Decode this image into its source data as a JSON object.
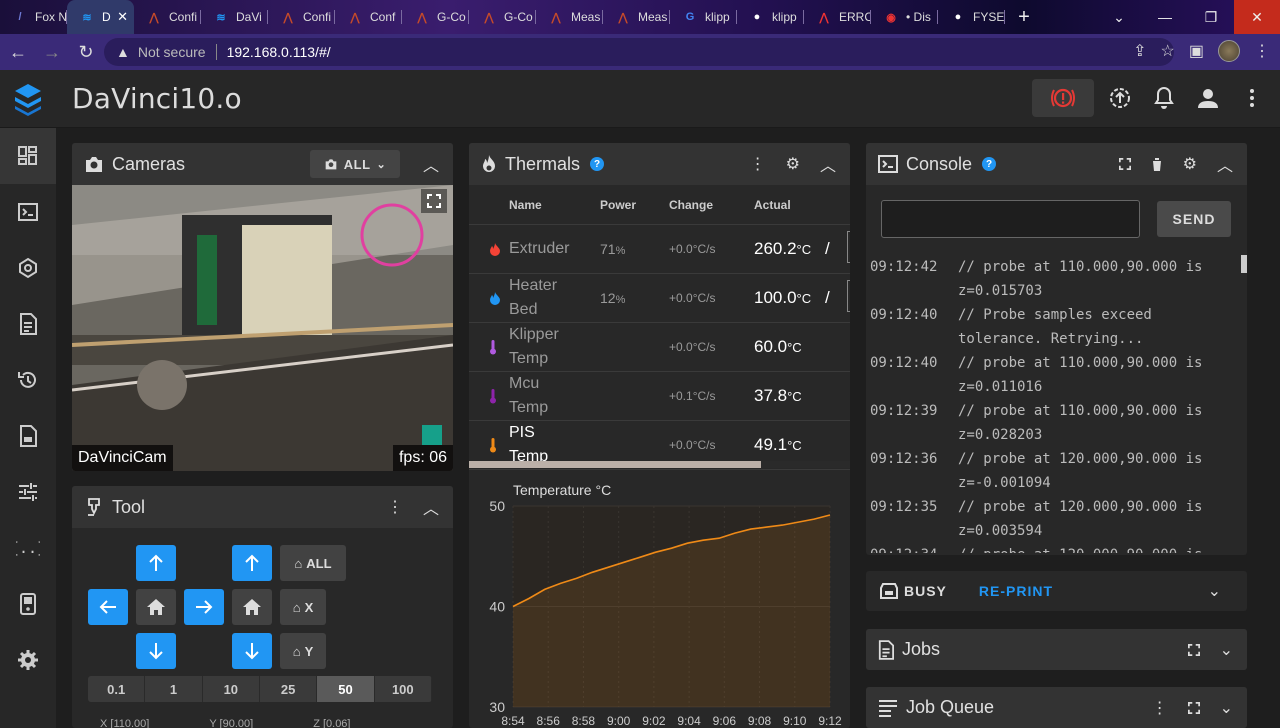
{
  "browser": {
    "tabs": [
      {
        "label": "Fox N",
        "favicon": "fox-icon",
        "color": "#6f7bd6"
      },
      {
        "label": "D",
        "favicon": "mainsail-icon",
        "color": "#2196f3",
        "active": true
      },
      {
        "label": "Confi",
        "favicon": "klipper-icon",
        "color": "#c44a2a"
      },
      {
        "label": "DaVi",
        "favicon": "mainsail-icon",
        "color": "#2196f3"
      },
      {
        "label": "Confi",
        "favicon": "klipper-icon",
        "color": "#c44a2a"
      },
      {
        "label": "Conf",
        "favicon": "klipper-icon",
        "color": "#c44a2a"
      },
      {
        "label": "G-Co",
        "favicon": "klipper-icon",
        "color": "#c44a2a"
      },
      {
        "label": "G-Co",
        "favicon": "klipper-icon",
        "color": "#c44a2a"
      },
      {
        "label": "Meas",
        "favicon": "klipper-icon",
        "color": "#c44a2a"
      },
      {
        "label": "Meas",
        "favicon": "klipper-icon",
        "color": "#c44a2a"
      },
      {
        "label": "klipp",
        "favicon": "google-icon",
        "color": "#4285f4"
      },
      {
        "label": "klipp",
        "favicon": "github-icon",
        "color": "#ffffff"
      },
      {
        "label": "ERRC",
        "favicon": "error-icon",
        "color": "#e33"
      },
      {
        "label": "• Dis",
        "favicon": "discord-icon",
        "color": "#e33"
      },
      {
        "label": "FYSE",
        "favicon": "github-icon",
        "color": "#ffffff"
      }
    ],
    "not_secure": "Not secure",
    "url": "192.168.0.113/#/"
  },
  "app": {
    "title": "DaVinci10.o"
  },
  "cameras": {
    "title": "Cameras",
    "select_label": "ALL",
    "cam_name": "DaVinciCam",
    "fps": "fps: 06"
  },
  "tool": {
    "title": "Tool",
    "home_all": "ALL",
    "home_x": "X",
    "home_y": "Y",
    "steps": [
      "0.1",
      "1",
      "10",
      "25",
      "50",
      "100"
    ],
    "selected_step": "50",
    "coords": [
      "X [110.00]",
      "Y [90.00]",
      "Z [0.06]"
    ]
  },
  "thermals": {
    "title": "Thermals",
    "headers": {
      "name": "Name",
      "power": "Power",
      "change": "Change",
      "actual": "Actual"
    },
    "rows": [
      {
        "name1": "Extruder",
        "name2": "",
        "power": "71",
        "unit": "%",
        "change": "+0.0°C/s",
        "actual": "260.2",
        "aunit": "°C",
        "icon": "flame-icon",
        "color": "#f44336",
        "target": true
      },
      {
        "name1": "Heater",
        "name2": "Bed",
        "power": "12",
        "unit": "%",
        "change": "+0.0°C/s",
        "actual": "100.0",
        "aunit": "°C",
        "icon": "heat-icon",
        "color": "#2196f3",
        "target": true
      },
      {
        "name1": "Klipper",
        "name2": "Temp",
        "power": "",
        "unit": "",
        "change": "+0.0°C/s",
        "actual": "60.0",
        "aunit": "°C",
        "icon": "thermometer-icon",
        "color": "#b05ae0",
        "target": false
      },
      {
        "name1": "Mcu",
        "name2": "Temp",
        "power": "",
        "unit": "",
        "change": "+0.1°C/s",
        "actual": "37.8",
        "aunit": "°C",
        "icon": "thermometer-icon",
        "color": "#8e24aa",
        "target": false
      },
      {
        "name1": "PIS",
        "name2": "Temp",
        "power": "",
        "unit": "",
        "change": "+0.0°C/s",
        "actual": "49.1",
        "aunit": "°C",
        "icon": "thermometer-icon",
        "color": "#ef8a17",
        "target": false
      }
    ]
  },
  "chart_data": {
    "type": "line",
    "ylabel": "Temperature °C",
    "ylim": [
      30,
      50
    ],
    "yticks": [
      30,
      40,
      50
    ],
    "xticks": [
      "8:54",
      "8:56",
      "8:58",
      "9:00",
      "9:02",
      "9:04",
      "9:06",
      "9:08",
      "9:10",
      "9:12"
    ],
    "x": [
      0,
      1,
      2,
      3,
      4,
      5,
      6,
      7,
      8,
      9,
      10,
      11,
      12,
      13,
      14,
      15,
      16,
      17,
      18,
      19,
      20
    ],
    "series": [
      {
        "color": "#ef8a17",
        "values": [
          40.0,
          40.8,
          41.7,
          42.3,
          42.8,
          43.4,
          43.9,
          44.4,
          44.9,
          45.4,
          45.8,
          46.3,
          46.6,
          46.8,
          47.3,
          47.7,
          47.9,
          48.1,
          48.4,
          48.7,
          49.1
        ]
      }
    ]
  },
  "console": {
    "title": "Console",
    "send": "SEND",
    "lines": [
      {
        "t": "09:12:42",
        "m": "// probe at 110.000,90.000 is z=0.015703"
      },
      {
        "t": "09:12:40",
        "m": "// Probe samples exceed tolerance. Retrying..."
      },
      {
        "t": "09:12:40",
        "m": "// probe at 110.000,90.000 is z=0.011016"
      },
      {
        "t": "09:12:39",
        "m": "// probe at 110.000,90.000 is z=0.028203"
      },
      {
        "t": "09:12:36",
        "m": "// probe at 120.000,90.000 is z=-0.001094"
      },
      {
        "t": "09:12:35",
        "m": "// probe at 120.000,90.000 is z=0.003594"
      },
      {
        "t": "09:12:34",
        "m": "// probe at 120.000,90.000 is"
      }
    ]
  },
  "status": {
    "busy": "BUSY",
    "reprint": "RE-PRINT"
  },
  "jobs": {
    "title": "Jobs"
  },
  "queue": {
    "title": "Job Queue"
  },
  "colors": {
    "accent": "#2196f3",
    "estop": "#e53935",
    "chart_line": "#ef8a17"
  }
}
